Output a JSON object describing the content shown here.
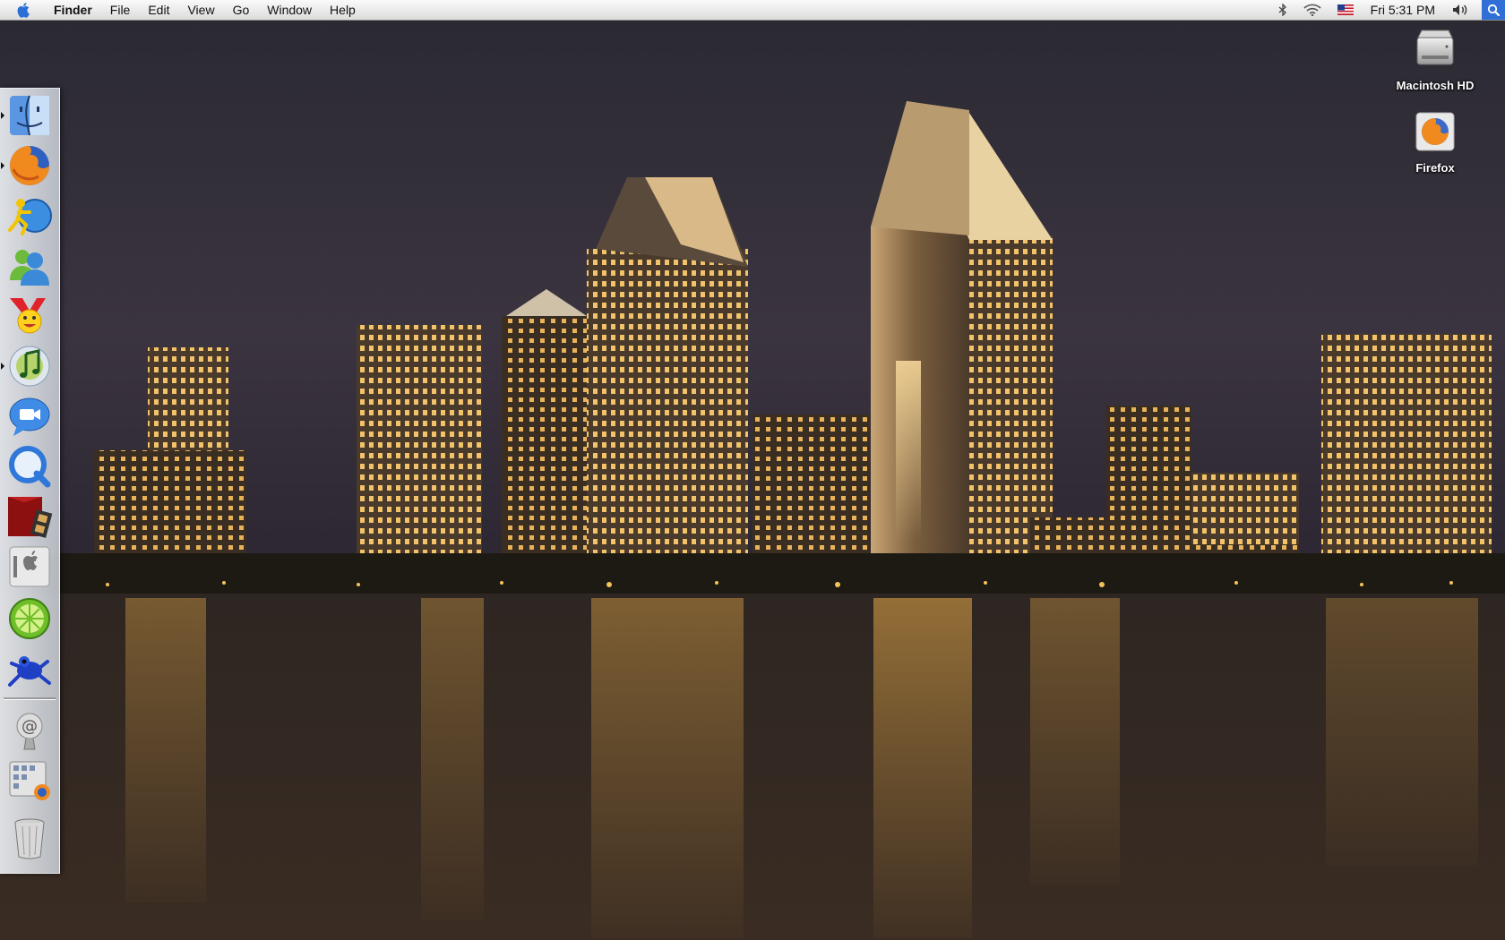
{
  "menubar": {
    "app_name": "Finder",
    "menus": [
      "File",
      "Edit",
      "View",
      "Go",
      "Window",
      "Help"
    ],
    "clock": "Fri 5:31 PM",
    "status_icons": [
      "bluetooth-icon",
      "wifi-icon",
      "us-flag-icon",
      "volume-icon",
      "spotlight-icon"
    ]
  },
  "desktop": {
    "icons": [
      {
        "label": "Macintosh HD",
        "icon": "hard-drive-icon"
      },
      {
        "label": "Firefox",
        "icon": "firefox-icon"
      }
    ]
  },
  "dock": {
    "items": [
      {
        "app": "finder",
        "icon": "finder-icon",
        "running": true
      },
      {
        "app": "firefox",
        "icon": "firefox-icon",
        "running": true
      },
      {
        "app": "aim",
        "icon": "aim-icon",
        "running": false
      },
      {
        "app": "messenger",
        "icon": "messenger-icon",
        "running": false
      },
      {
        "app": "yahoo-messenger",
        "icon": "yahoo-messenger-icon",
        "running": false
      },
      {
        "app": "itunes",
        "icon": "itunes-icon",
        "running": true
      },
      {
        "app": "ichat",
        "icon": "ichat-icon",
        "running": false
      },
      {
        "app": "quicktime",
        "icon": "quicktime-icon",
        "running": false
      },
      {
        "app": "front-row",
        "icon": "front-row-icon",
        "running": false
      },
      {
        "app": "boot-camp",
        "icon": "boot-camp-icon",
        "running": false
      },
      {
        "app": "limewire",
        "icon": "limewire-icon",
        "running": false
      },
      {
        "app": "frog-app",
        "icon": "frog-icon",
        "running": false
      },
      {
        "app": "mail-stack",
        "icon": "mail-stack-icon",
        "running": false
      },
      {
        "app": "applications-stack",
        "icon": "applications-stack-icon",
        "running": false
      },
      {
        "app": "trash",
        "icon": "trash-icon",
        "running": false
      }
    ]
  },
  "colors": {
    "menubar": "#e8e8e8",
    "spotlight": "#2f6fd6",
    "sky": "#3a3440",
    "water": "#2d2219",
    "city_lights": "#f5c76a"
  }
}
